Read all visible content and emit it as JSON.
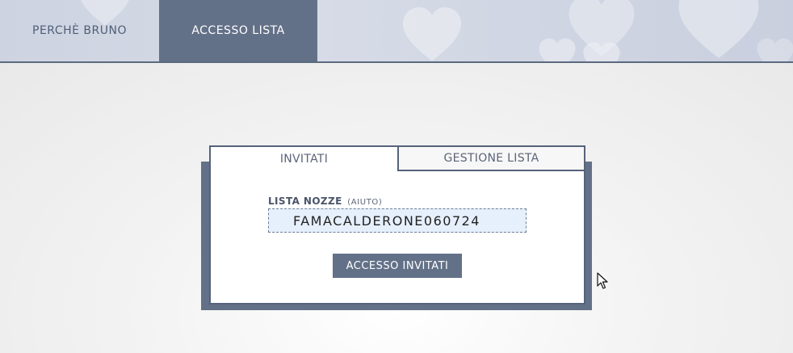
{
  "nav": {
    "items": [
      {
        "label": "PERCHÈ BRUNO",
        "active": false
      },
      {
        "label": "ACCESSO LISTA",
        "active": true
      }
    ]
  },
  "panel": {
    "tabs": [
      {
        "label": "INVITATI",
        "active": true
      },
      {
        "label": "GESTIONE LISTA",
        "active": false
      }
    ],
    "field_label": "LISTA NOZZE",
    "field_help": "(AIUTO)",
    "field_value": "FAMACALDERONE060724",
    "submit_label": "ACCESSO INVITATI"
  },
  "colors": {
    "accent": "#637188",
    "header_bg": "#cdd3e0",
    "input_bg": "#e6f0fc"
  },
  "icons": {
    "cursor": "mouse-pointer-icon",
    "decor": "heart-icon"
  }
}
